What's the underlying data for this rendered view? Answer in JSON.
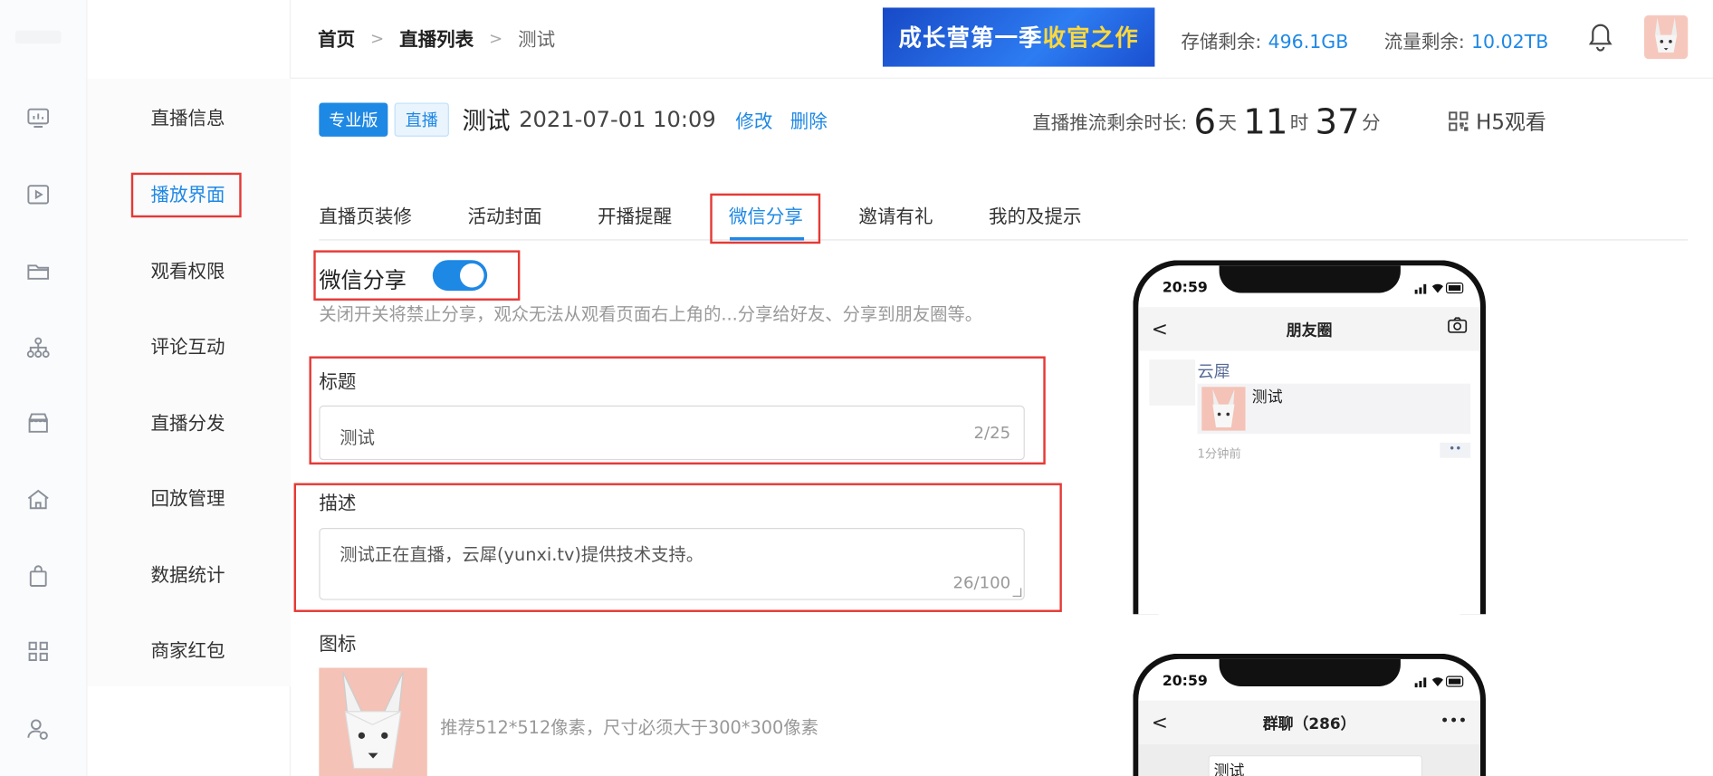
{
  "header": {
    "breadcrumb": [
      "首页",
      "直播列表",
      "测试"
    ],
    "banner_main": "成长营第一季",
    "banner_highlight": "收官之作",
    "storage_label": "存储剩余:",
    "storage_value": "496.1GB",
    "traffic_label": "流量剩余:",
    "traffic_value": "10.02TB"
  },
  "sidebar": {
    "items": [
      {
        "label": "直播信息"
      },
      {
        "label": "播放界面"
      },
      {
        "label": "观看权限"
      },
      {
        "label": "评论互动"
      },
      {
        "label": "直播分发"
      },
      {
        "label": "回放管理"
      },
      {
        "label": "数据统计"
      },
      {
        "label": "商家红包"
      }
    ],
    "active": "播放界面"
  },
  "rail_icons": [
    "monitor-icon",
    "video-icon",
    "folder-icon",
    "org-chart-icon",
    "store-icon",
    "home-icon",
    "bag-icon",
    "grid-icon",
    "user-settings-icon"
  ],
  "live": {
    "tag_pro": "专业版",
    "tag_live": "直播",
    "title": "测试",
    "datetime": "2021-07-01 10:09",
    "edit": "修改",
    "delete": "删除",
    "remain_label": "直播推流剩余时长:",
    "days": "6",
    "days_unit": "天",
    "hours": "11",
    "hours_unit": "时",
    "minutes": "37",
    "minutes_unit": "分",
    "h5_watch": "H5观看"
  },
  "tabs": [
    "直播页装修",
    "活动封面",
    "开播提醒",
    "微信分享",
    "邀请有礼",
    "我的及提示"
  ],
  "active_tab": "微信分享",
  "form": {
    "share_label": "微信分享",
    "share_enabled": true,
    "share_hint": "关闭开关将禁止分享，观众无法从观看页面右上角的...分享给好友、分享到朋友圈等。",
    "title_label": "标题",
    "title_value": "测试",
    "title_count": "2/25",
    "desc_label": "描述",
    "desc_value": "测试正在直播，云犀(yunxi.tv)提供技术支持。",
    "desc_count": "26/100",
    "icon_label": "图标",
    "icon_hint": "推荐512*512像素，尺寸必须大于300*300像素"
  },
  "preview1": {
    "time": "20:59",
    "nav_title": "朋友圈",
    "user": "云犀",
    "card_title": "测试",
    "ago": "1分钟前",
    "more": "••"
  },
  "preview2": {
    "time": "20:59",
    "nav_title": "群聊（286）",
    "more": "•••",
    "msg": "测试"
  },
  "colors": {
    "accent": "#1e88e5",
    "highlight_box": "#e53935"
  }
}
